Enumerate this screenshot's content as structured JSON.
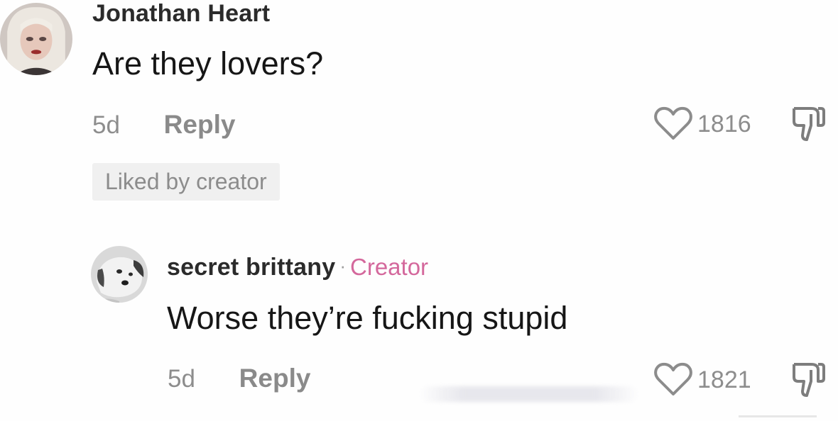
{
  "comment": {
    "username": "Jonathan Heart",
    "text": "Are they lovers?",
    "time": "5d",
    "reply_label": "Reply",
    "like_count": "1816",
    "badge": "Liked by creator",
    "avatar_icon": "user-avatar"
  },
  "reply": {
    "username": "secret brittany",
    "separator": "·",
    "creator_label": "Creator",
    "text": "Worse they’re fucking stupid",
    "time": "5d",
    "reply_label": "Reply",
    "like_count": "1821",
    "avatar_icon": "dog-avatar"
  },
  "icons": {
    "like": "heart-outline-icon",
    "dislike": "thumbs-down-icon"
  },
  "colors": {
    "creator_tag": "#d4689c",
    "meta_text": "#8d8d8d",
    "badge_bg": "#f0f0f0"
  }
}
